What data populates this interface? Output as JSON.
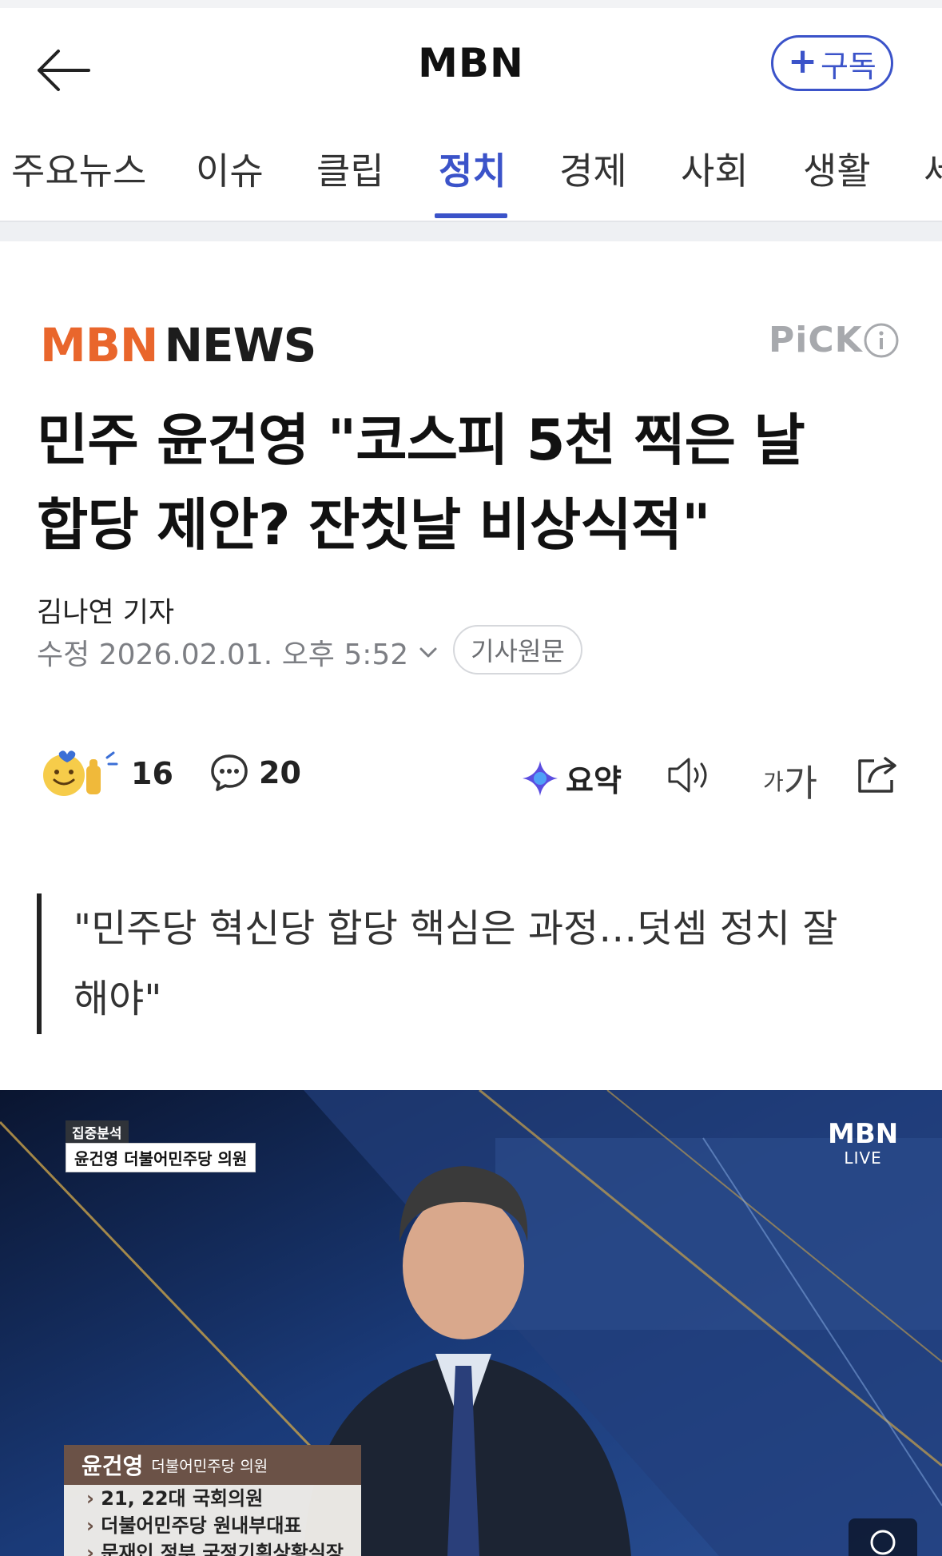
{
  "header": {
    "back_icon": "arrow-left-icon",
    "title": "MBN",
    "subscribe_label": "구독"
  },
  "tabs": [
    {
      "label": "주요뉴스"
    },
    {
      "label": "이슈"
    },
    {
      "label": "클립"
    },
    {
      "label": "정치",
      "active": true
    },
    {
      "label": "경제"
    },
    {
      "label": "사회"
    },
    {
      "label": "생활"
    },
    {
      "label": "세"
    }
  ],
  "article": {
    "source_logo_mbn": "MBN",
    "source_logo_news": "NEWS",
    "pick_label": "PiCK",
    "headline_line1": "민주 윤건영 \"코스피 5천 찍은 날",
    "headline_line2": "합당 제안? 잔칫날 비상식적\"",
    "reporter": "김나연 기자",
    "date": "수정 2026.02.01. 오후 5:52",
    "original_label": "기사원문",
    "reactions_count": "16",
    "comments_count": "20",
    "summary_label": "요약",
    "font_small": "가",
    "font_large": "가",
    "quote_line1": "\"민주당 혁신당 합당 핵심은 과정…덧셈 정치 잘",
    "quote_line2": "해야\""
  },
  "media": {
    "tag": "집중분석",
    "caption": "윤건영 더불어민주당 의원",
    "live_logo": "MBN",
    "live_label": "LIVE",
    "card_name": "윤건영",
    "card_role": "더불어민주당 의원",
    "card_items": [
      "21, 22대 국회의원",
      "더불어민주당 원내부대표",
      "문재인 정부 국정기획상황실장"
    ]
  },
  "colors": {
    "accent": "#3b53c9",
    "mbn_orange": "#e9662c"
  }
}
